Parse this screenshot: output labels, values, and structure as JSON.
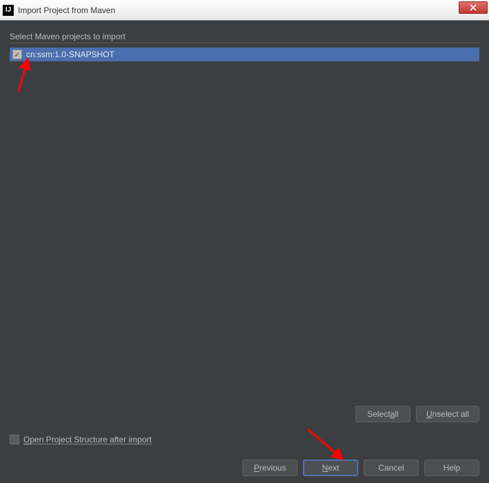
{
  "titlebar": {
    "title": "Import Project from Maven",
    "icon_text": "IJ"
  },
  "section_label": "Select Maven projects to import",
  "projects": [
    {
      "label": "cn:ssm:1.0-SNAPSHOT",
      "checked": true
    }
  ],
  "selection": {
    "select_all": "Select all",
    "unselect_all": "Unselect all"
  },
  "open_structure": {
    "label": "Open Project Structure after import",
    "checked": false
  },
  "wizard": {
    "previous": "Previous",
    "next": "Next",
    "cancel": "Cancel",
    "help": "Help"
  }
}
